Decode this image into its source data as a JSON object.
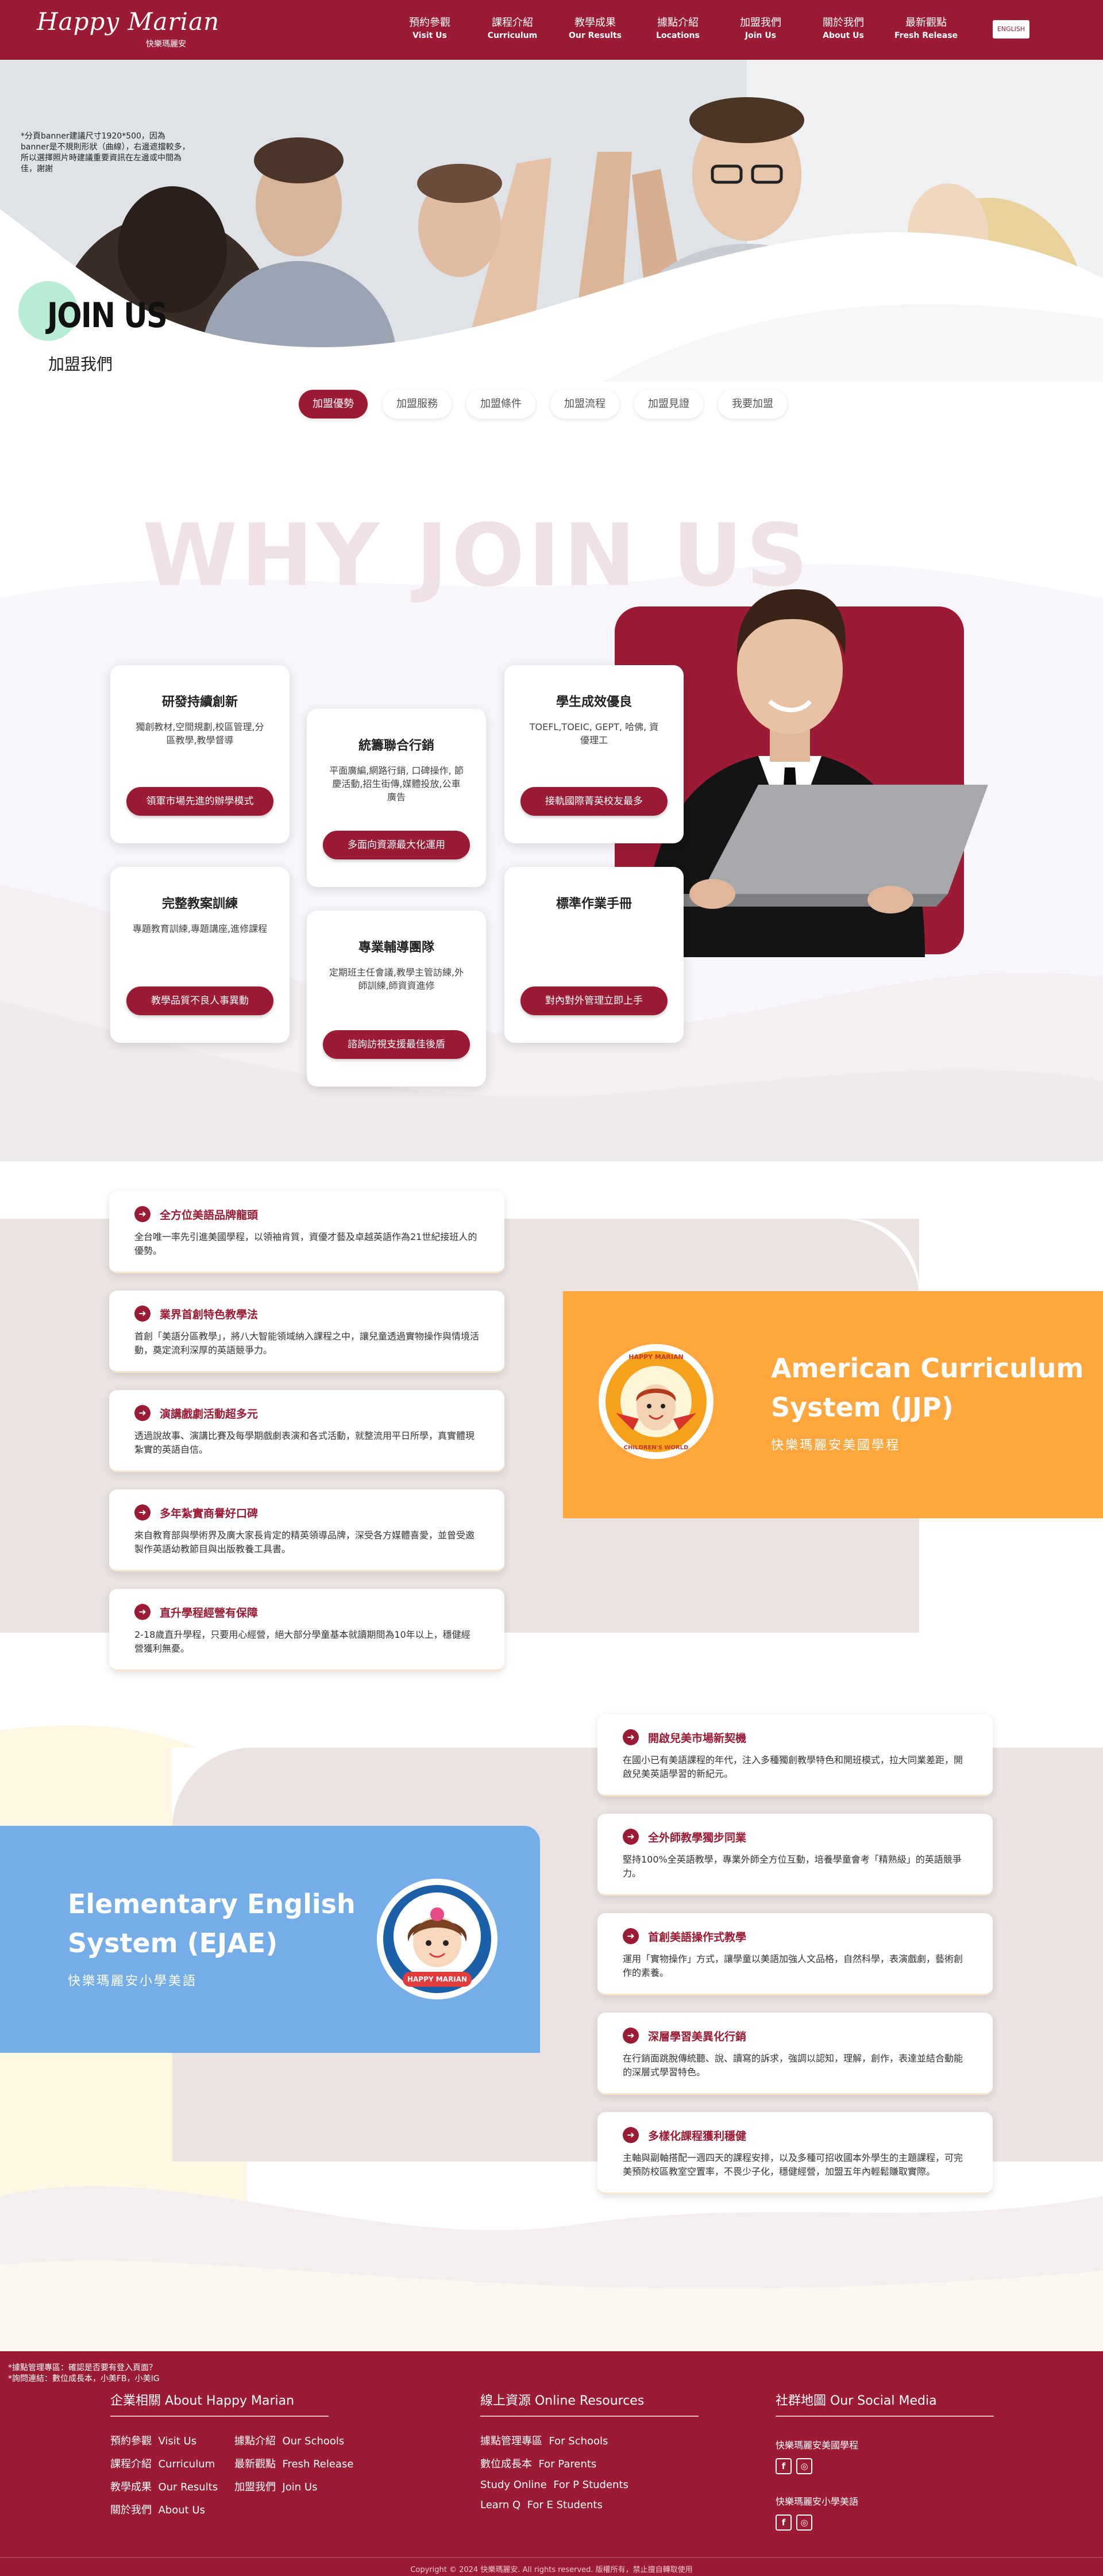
{
  "colors": {
    "brand": "#9b1b34",
    "orange": "#ffa63d",
    "blue": "#75ade9",
    "mint": "#b8ecd5",
    "sand": "#ebe3e2"
  },
  "header": {
    "logo_main": "Happy Marian",
    "logo_sub": "快樂瑪麗安",
    "nav": [
      {
        "zh": "預約參觀",
        "en": "Visit Us"
      },
      {
        "zh": "課程介紹",
        "en": "Curriculum"
      },
      {
        "zh": "教學成果",
        "en": "Our Results"
      },
      {
        "zh": "據點介紹",
        "en": "Locations"
      },
      {
        "zh": "加盟我們",
        "en": "Join Us"
      },
      {
        "zh": "關於我們",
        "en": "About Us"
      },
      {
        "zh": "最新觀點",
        "en": "Fresh Release"
      }
    ],
    "lang": "ENGLISH"
  },
  "hero": {
    "note": "*分頁banner建議尺寸1920*500，因為banner是不規則形狀（曲線），右邊遮擋較多，所以選擇照片時建議重要資訊在左邊或中間為佳，謝謝",
    "title": "JOIN US",
    "subtitle": "加盟我們"
  },
  "tabs": [
    "加盟優勢",
    "加盟服務",
    "加盟條件",
    "加盟流程",
    "加盟見證",
    "我要加盟"
  ],
  "why": {
    "title": "WHY JOIN US",
    "cards": [
      {
        "title": "研發持續創新",
        "desc": "獨創教材,空間規劃,校區管理,分區教學,教學督導",
        "button": "領軍市場先進的辦學模式"
      },
      {
        "title": "統籌聯合行銷",
        "desc": "平面廣編,網路行銷, 口碑操作, 節慶活動,招生街傳,媒體投放,公車廣告",
        "button": "多面向資源最大化運用"
      },
      {
        "title": "學生成效優良",
        "desc": "TOEFL,TOEIC, GEPT, 哈佛, 資優理工",
        "button": "接軌國際菁英校友最多"
      },
      {
        "title": "完整教案訓練",
        "desc": "專題教育訓練,專題講座,進修課程",
        "button": "教學品質不良人事異動"
      },
      {
        "title": "專業輔導團隊",
        "desc": "定期班主任會議,教學主管訪練,外師訓練,師資資進修",
        "button": "諮詢訪視支援最佳後盾"
      },
      {
        "title": "標準作業手冊",
        "desc": "",
        "button": "對內對外管理立即上手"
      }
    ]
  },
  "jjp": {
    "title_line1": "American Curriculum",
    "title_line2": "System (JJP)",
    "subtitle": "快樂瑪麗安美國學程",
    "badge_top": "HAPPY MARIAN",
    "badge_bottom": "CHILDREN'S WORLD",
    "features": [
      {
        "title": "全方位美語品牌龍頭",
        "desc": "全台唯一率先引進美國學程，以領袖肯質，資優才藝及卓越英語作為21世紀接班人的優勢。"
      },
      {
        "title": "業界首創特色教學法",
        "desc": "首創「美語分區教學」，將八大智能領域納入課程之中，讓兒童透過實物操作與情境活動，奠定流利深厚的英語競爭力。"
      },
      {
        "title": "演講戲劇活動超多元",
        "desc": "透過說故事、演講比賽及每學期戲劇表演和各式活動，就整流用平日所學，真實體現紮實的英語自信。"
      },
      {
        "title": "多年紮實商譽好口碑",
        "desc": "來自教育部與學術界及廣大家長肯定的精英領導品牌，深受各方媒體喜愛，並曾受邀製作英語幼教節目與出版教養工具書。"
      },
      {
        "title": "直升學程經營有保障",
        "desc": "2-18歲直升學程，只要用心經營，絕大部分學童基本就讀期間為10年以上，穩健經營獲利無憂。"
      }
    ]
  },
  "ejae": {
    "title_line1": "Elementary English",
    "title_line2": "System (EJAE)",
    "subtitle": "快樂瑪麗安小學美語",
    "badge_bottom": "HAPPY MARIAN",
    "features": [
      {
        "title": "開啟兒美市場新契機",
        "desc": "在國小已有美語課程的年代，注入多種獨創教學特色和開班模式，拉大同業差距，開啟兒美英語學習的新紀元。"
      },
      {
        "title": "全外師教學獨步同業",
        "desc": "堅持100%全英語教學，專業外師全方位互動，培養學童會考「精熟級」的英語競爭力。"
      },
      {
        "title": "首創美語操作式教學",
        "desc": "運用「實物操作」方式，讓學童以美語加強人文品格，自然科學，表演戲劇，藝術創作的素養。"
      },
      {
        "title": "深層學習美異化行銷",
        "desc": "在行銷面跳脫傳統聽、說、讀寫的訴求，強調以認知，理解，創作，表達並結合動能的深層式學習特色。"
      },
      {
        "title": "多樣化課程獲利穩健",
        "desc": "主軸與副軸搭配一週四天的課程安排，以及多種可招收國本外學生的主題課程，可完美預防校區教室空置率，不畏少子化，穩健經營，加盟五年內輕鬆賺取實際。"
      }
    ]
  },
  "footer": {
    "note_lines": [
      "*據點管理專區：確認是否要有登入頁面？",
      "*詢問連結：數位成長本，小美FB，小美IG"
    ],
    "about": {
      "heading": "企業相關 About Happy Marian",
      "links": [
        [
          "預約參觀",
          "Visit Us"
        ],
        [
          "據點介紹",
          "Our Schools"
        ],
        [
          "課程介紹",
          "Curriculum"
        ],
        [
          "最新觀點",
          "Fresh Release"
        ],
        [
          "教學成果",
          "Our Results"
        ],
        [
          "加盟我們",
          "Join Us"
        ],
        [
          "關於我們",
          "About Us"
        ]
      ]
    },
    "online": {
      "heading": "線上資源 Online Resources",
      "links": [
        [
          "據點管理專區",
          "For Schools"
        ],
        [
          "數位成長本",
          "For Parents"
        ],
        [
          "Study Online",
          "For P Students"
        ],
        [
          "Learn Q",
          "For E Students"
        ]
      ]
    },
    "social": {
      "heading": "社群地圖 Our Social Media",
      "groups": [
        "快樂瑪麗安美國學程",
        "快樂瑪麗安小學美語"
      ],
      "icons": [
        "f",
        "◎"
      ]
    },
    "copyright": "Copyright © 2024 快樂瑪麗安. All rights reserved. 版權所有，禁止擅自轉取使用"
  }
}
